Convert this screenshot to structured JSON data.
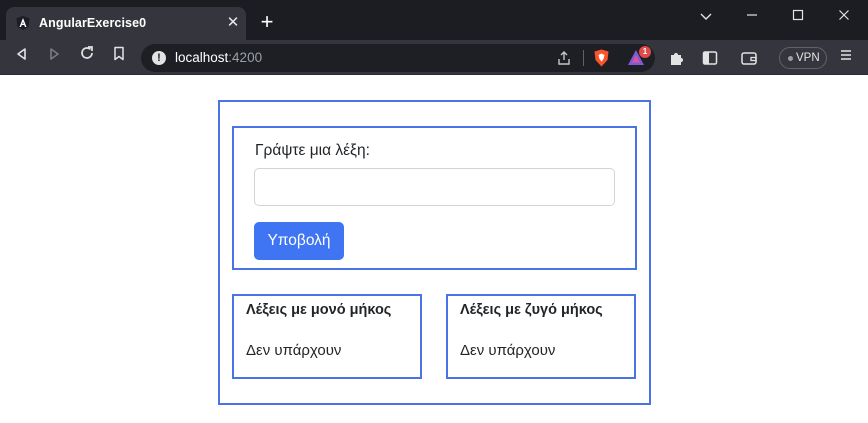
{
  "browser": {
    "tab_title": "AngularExercise0",
    "tab_close": "✕",
    "new_tab": "+",
    "url_host": "localhost",
    "url_port": ":4200",
    "rewards_badge": "1",
    "vpn_label": "VPN",
    "window_controls": [
      "minimize",
      "maximize",
      "close"
    ],
    "icons": [
      "back-icon",
      "forward-icon",
      "reload-icon",
      "bookmark-icon",
      "info-icon",
      "share-icon",
      "brave-shields-icon",
      "brave-rewards-icon",
      "extensions-icon",
      "sidebar-icon",
      "wallet-icon",
      "menu-icon"
    ]
  },
  "form": {
    "label": "Γράψτε μια λέξη:",
    "input_value": "",
    "submit_label": "Υποβολή"
  },
  "lists": {
    "odd": {
      "title": "Λέξεις με μονό μήκος",
      "empty_text": "Δεν υπάρχουν"
    },
    "even": {
      "title": "Λέξεις με ζυγό μήκος",
      "empty_text": "Δεν υπάρχουν"
    }
  },
  "colors": {
    "accent": "#4a74e6",
    "button": "#3f74f3",
    "chrome_dark": "#1c1d22",
    "chrome_toolbar": "#35363d"
  }
}
